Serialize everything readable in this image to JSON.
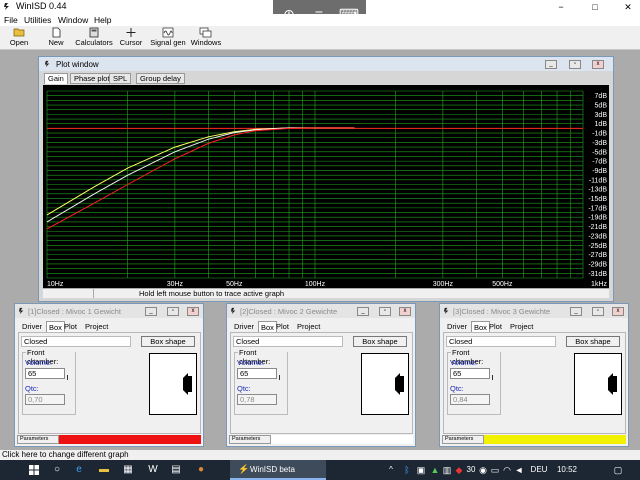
{
  "app": {
    "title": "WinISD 0.44"
  },
  "window_controls": {
    "minimize": "−",
    "maximize": "□",
    "close": "✕"
  },
  "overlay": {
    "zoom_icon": "⊕",
    "menu_icon": "≡",
    "keyboard_icon": "⌨"
  },
  "menu": [
    "File",
    "Utilities",
    "Window",
    "Help"
  ],
  "toolbar": [
    {
      "label": "Open",
      "icon": "folder-icon"
    },
    {
      "label": "New",
      "icon": "new-document-icon"
    },
    {
      "label": "Calculators",
      "icon": "calculator-icon"
    },
    {
      "label": "Cursor",
      "icon": "crosshair-icon"
    },
    {
      "label": "Signal gen",
      "icon": "signal-icon"
    },
    {
      "label": "Windows",
      "icon": "windows-icon"
    }
  ],
  "plot_window": {
    "title": "Plot window",
    "tabs": [
      "Gain",
      "Phase plot",
      "SPL",
      "Group delay"
    ],
    "active_tab": "Gain",
    "status": "Hold left mouse button to trace active graph"
  },
  "chart_data": {
    "type": "line",
    "x_scale": "log",
    "xlim": [
      10,
      1000
    ],
    "x_tick_labels": [
      "10Hz",
      "30Hz",
      "50Hz",
      "100Hz",
      "300Hz",
      "500Hz",
      "1kHz"
    ],
    "x_ticks": [
      10,
      30,
      50,
      100,
      300,
      500,
      1000
    ],
    "ylim": [
      -32,
      8
    ],
    "y_tick_labels": [
      "7dB",
      "5dB",
      "3dB",
      "1dB",
      "-1dB",
      "-3dB",
      "-5dB",
      "-7dB",
      "-9dB",
      "-11dB",
      "-13dB",
      "-15dB",
      "-17dB",
      "-19dB",
      "-21dB",
      "-23dB",
      "-25dB",
      "-27dB",
      "-29dB",
      "-31dB"
    ],
    "y_ticks": [
      7,
      5,
      3,
      1,
      -1,
      -3,
      -5,
      -7,
      -9,
      -11,
      -13,
      -15,
      -17,
      -19,
      -21,
      -23,
      -25,
      -27,
      -29,
      -31
    ],
    "grid": true,
    "background": "#000000",
    "grid_color": "#1fa51f",
    "series": [
      {
        "color": "#ffff66",
        "x": [
          10,
          15,
          20,
          30,
          40,
          50,
          60,
          80,
          100,
          140
        ],
        "y": [
          -18.5,
          -12.5,
          -8.5,
          -4.0,
          -1.8,
          -0.7,
          -0.2,
          0.1,
          0.1,
          0.1
        ]
      },
      {
        "color": "#f0f0f0",
        "x": [
          10,
          15,
          20,
          30,
          40,
          50,
          60,
          80,
          100,
          140
        ],
        "y": [
          -20.0,
          -14.0,
          -10.0,
          -5.0,
          -2.3,
          -0.9,
          -0.3,
          0.1,
          0.1,
          0.1
        ]
      },
      {
        "color": "#ff2020",
        "x": [
          10,
          15,
          20,
          30,
          40,
          50,
          60,
          80,
          100,
          140
        ],
        "y": [
          -21.5,
          -16.0,
          -12.0,
          -6.5,
          -3.2,
          -1.4,
          -0.5,
          0.0,
          0.1,
          0.1
        ]
      }
    ],
    "reference_line": {
      "y": 0,
      "color": "#ff2020"
    }
  },
  "box_windows": [
    {
      "title": "[1]Closed : Mivoc 1 Gewicht",
      "tabs": [
        "Driver",
        "Box",
        "Plot",
        "Project"
      ],
      "active_tab": "Box",
      "type": "Closed",
      "box_shape_label": "Box shape",
      "front_chamber_label": "Front chamber:",
      "volume_label": "Volume:",
      "volume": "65",
      "qtc_label": "Qtc:",
      "qtc": "0,70",
      "params_label": "Parameters",
      "color": "#ee1111"
    },
    {
      "title": "[2]Closed : Mivoc 2 Gewichte",
      "tabs": [
        "Driver",
        "Box",
        "Plot",
        "Project"
      ],
      "active_tab": "Box",
      "type": "Closed",
      "box_shape_label": "Box shape",
      "front_chamber_label": "Front chamber:",
      "volume_label": "Volume:",
      "volume": "65",
      "qtc_label": "Qtc:",
      "qtc": "0,78",
      "params_label": "Parameters",
      "color": "#ffffff"
    },
    {
      "title": "[3]Closed : Mivoc 3 Gewichte",
      "tabs": [
        "Driver",
        "Box",
        "Plot",
        "Project"
      ],
      "active_tab": "Box",
      "type": "Closed",
      "box_shape_label": "Box shape",
      "front_chamber_label": "Front chamber:",
      "volume_label": "Volume:",
      "volume": "65",
      "qtc_label": "Qtc:",
      "qtc": "0,84",
      "params_label": "Parameters",
      "color": "#f2f200"
    }
  ],
  "app_status": "Click here to change different graph",
  "taskbar": {
    "active_app": "WinISD beta",
    "tray_number": "30",
    "language": "DEU",
    "time": "10:52"
  }
}
